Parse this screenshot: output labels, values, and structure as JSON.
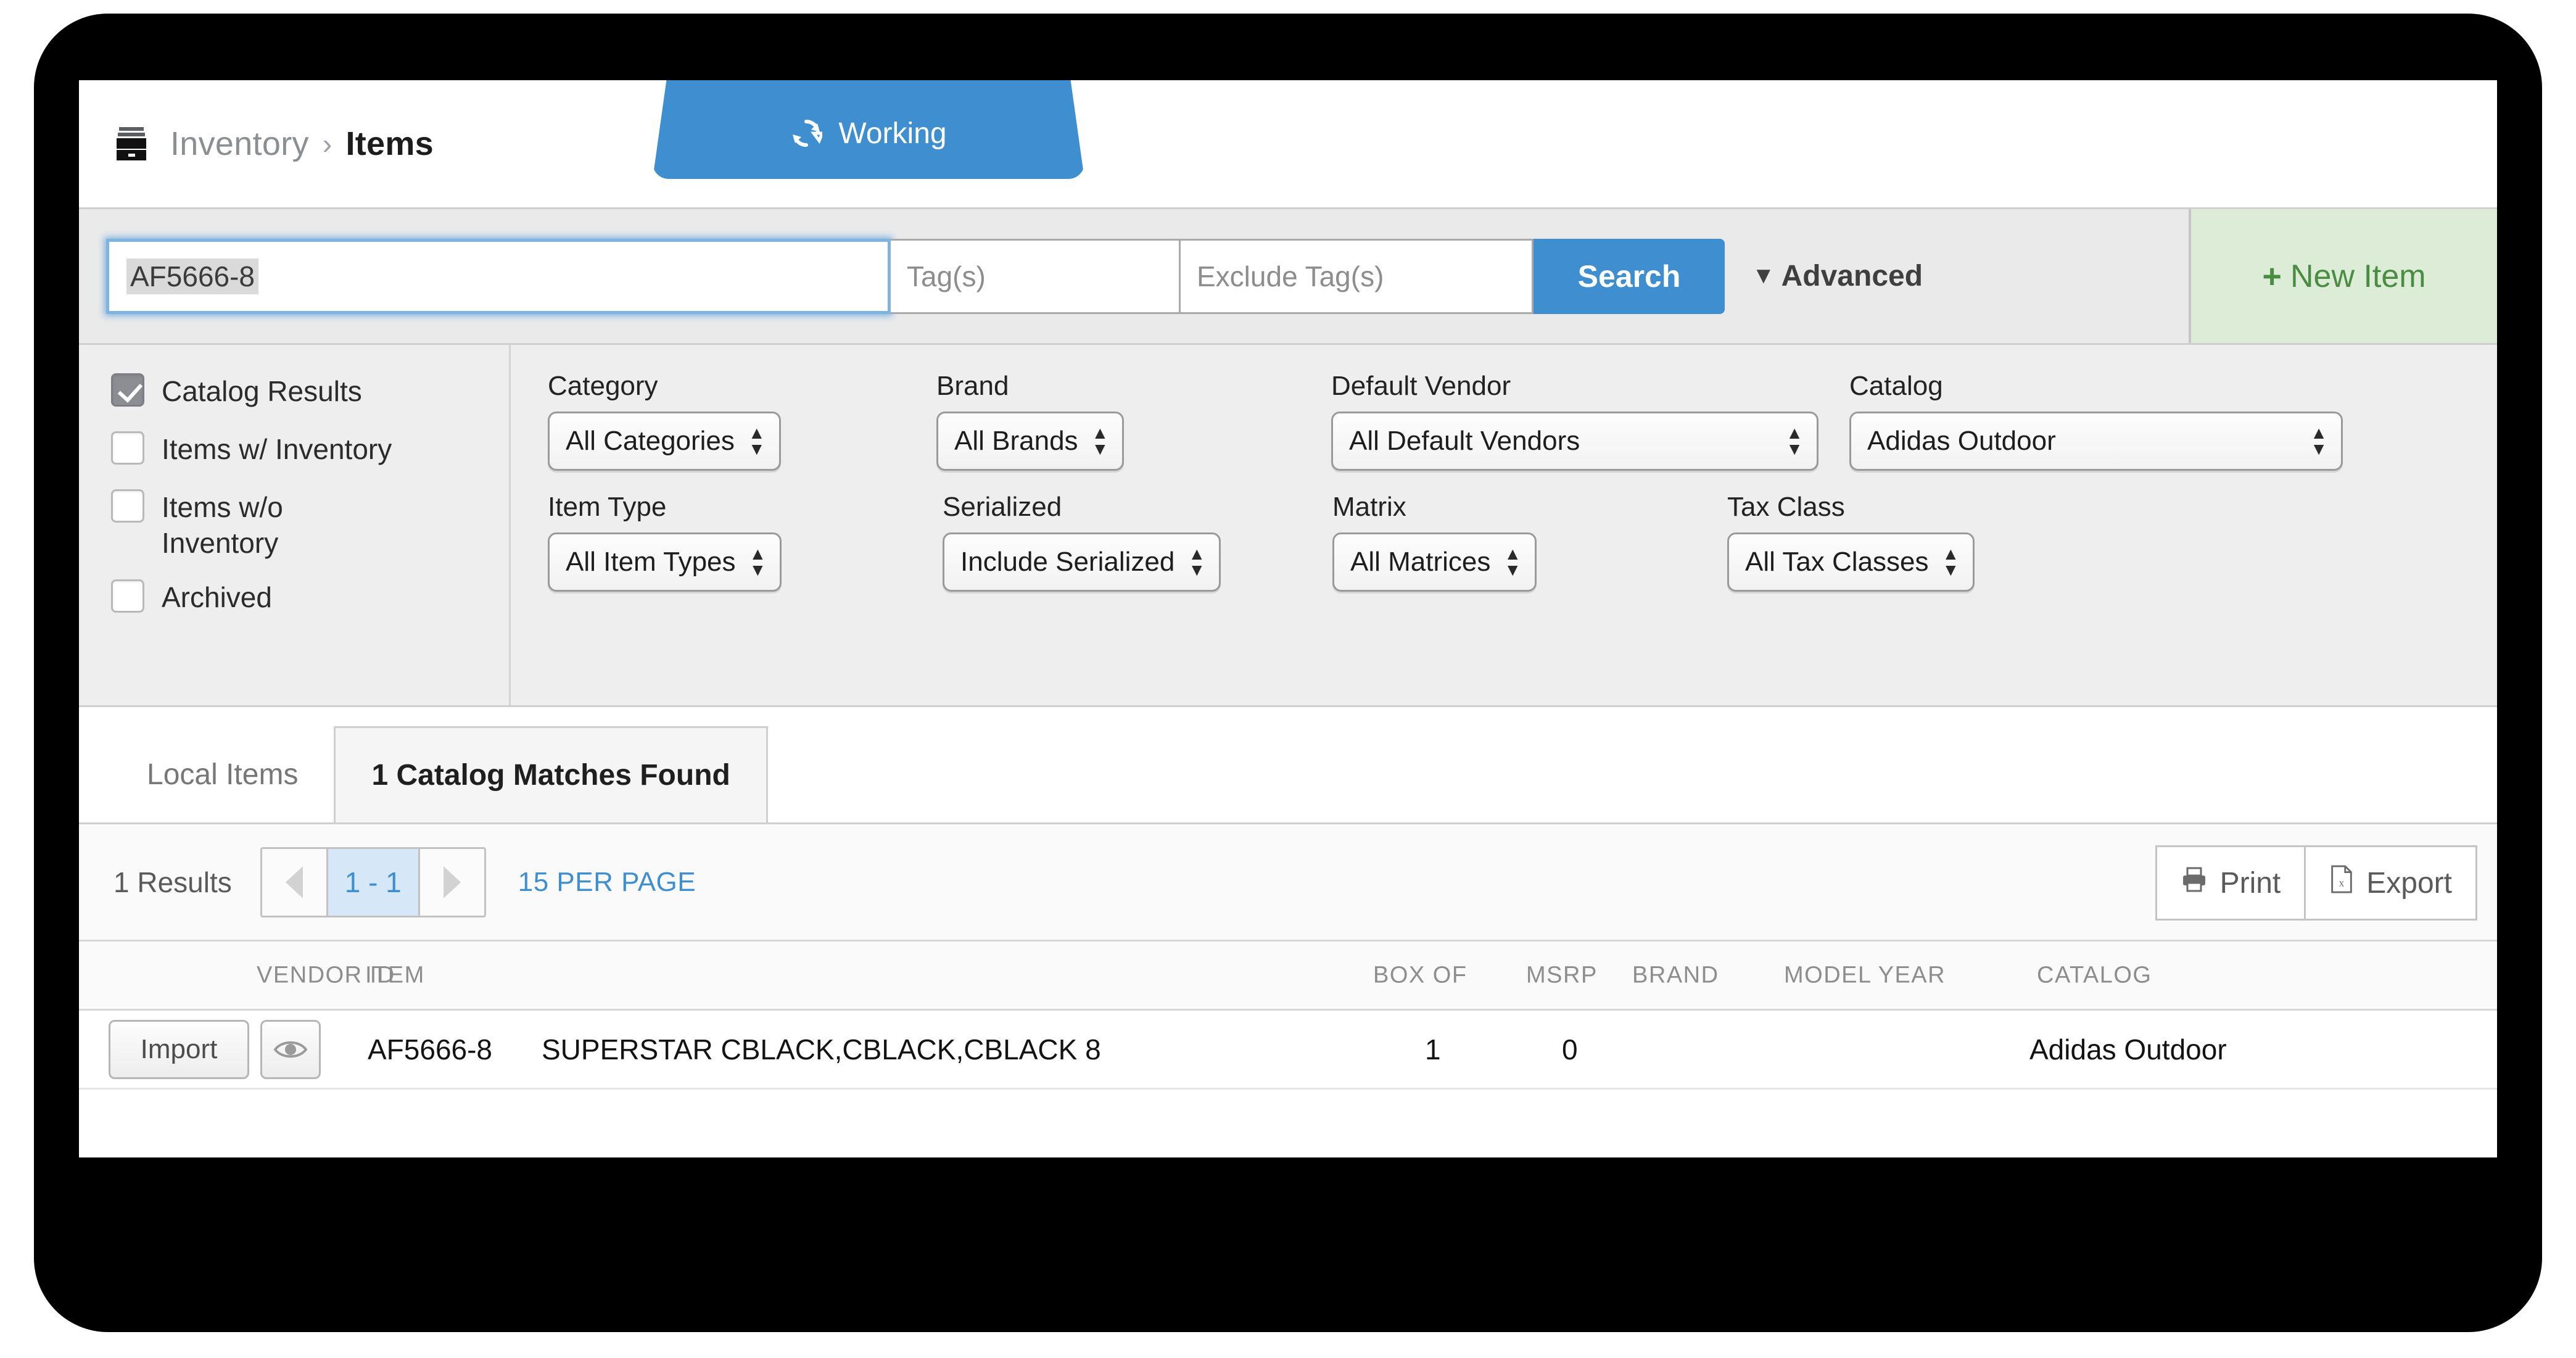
{
  "header": {
    "icon": "archive-box-icon",
    "breadcrumb_parent": "Inventory",
    "breadcrumb_sep": "›",
    "breadcrumb_current": "Items",
    "status_tab": {
      "icon": "sync-refresh-icon",
      "label": "Working",
      "color": "#3e8ed0"
    }
  },
  "search": {
    "query_value": "AF5666-8",
    "tags_placeholder": "Tag(s)",
    "exclude_tags_placeholder": "Exclude Tag(s)",
    "search_button": "Search",
    "advanced_label": "Advanced",
    "advanced_icon": "chevron-down-icon",
    "new_item_label": "New Item",
    "new_item_icon": "plus-icon",
    "new_item_color": "#4a8c42"
  },
  "filters": {
    "checkboxes": [
      {
        "label": "Catalog Results",
        "checked": true
      },
      {
        "label": "Items w/ Inventory",
        "checked": false
      },
      {
        "label": "Items w/o Inventory",
        "checked": false
      },
      {
        "label": "Archived",
        "checked": false
      }
    ],
    "row1": [
      {
        "label": "Category",
        "value": "All Categories"
      },
      {
        "label": "Brand",
        "value": "All Brands"
      },
      {
        "label": "Default Vendor",
        "value": "All Default Vendors"
      },
      {
        "label": "Catalog",
        "value": "Adidas Outdoor"
      }
    ],
    "row2": [
      {
        "label": "Item Type",
        "value": "All Item Types"
      },
      {
        "label": "Serialized",
        "value": "Include Serialized"
      },
      {
        "label": "Matrix",
        "value": "All Matrices"
      },
      {
        "label": "Tax Class",
        "value": "All Tax Classes"
      }
    ]
  },
  "tabs": [
    {
      "label": "Local Items",
      "active": false
    },
    {
      "label": "1 Catalog Matches Found",
      "active": true
    }
  ],
  "pagination": {
    "results_text": "1 Results",
    "prev_icon": "chevron-left-icon",
    "next_icon": "chevron-right-icon",
    "current_page": "1 - 1",
    "per_page_label": "15 PER PAGE",
    "link_color": "#3e8ed0"
  },
  "toolbar": {
    "print_label": "Print",
    "print_icon": "printer-icon",
    "export_label": "Export",
    "export_icon": "excel-file-icon"
  },
  "table": {
    "columns": [
      "VENDOR ID",
      "ITEM",
      "BOX OF",
      "MSRP",
      "BRAND",
      "MODEL YEAR",
      "CATALOG"
    ],
    "rows": [
      {
        "import_label": "Import",
        "view_icon": "eye-icon",
        "vendor_id": "AF5666-8",
        "item": "SUPERSTAR CBLACK,CBLACK,CBLACK 8",
        "box_of": "1",
        "msrp": "0",
        "brand": "",
        "model_year": "",
        "catalog": "Adidas Outdoor"
      }
    ]
  }
}
